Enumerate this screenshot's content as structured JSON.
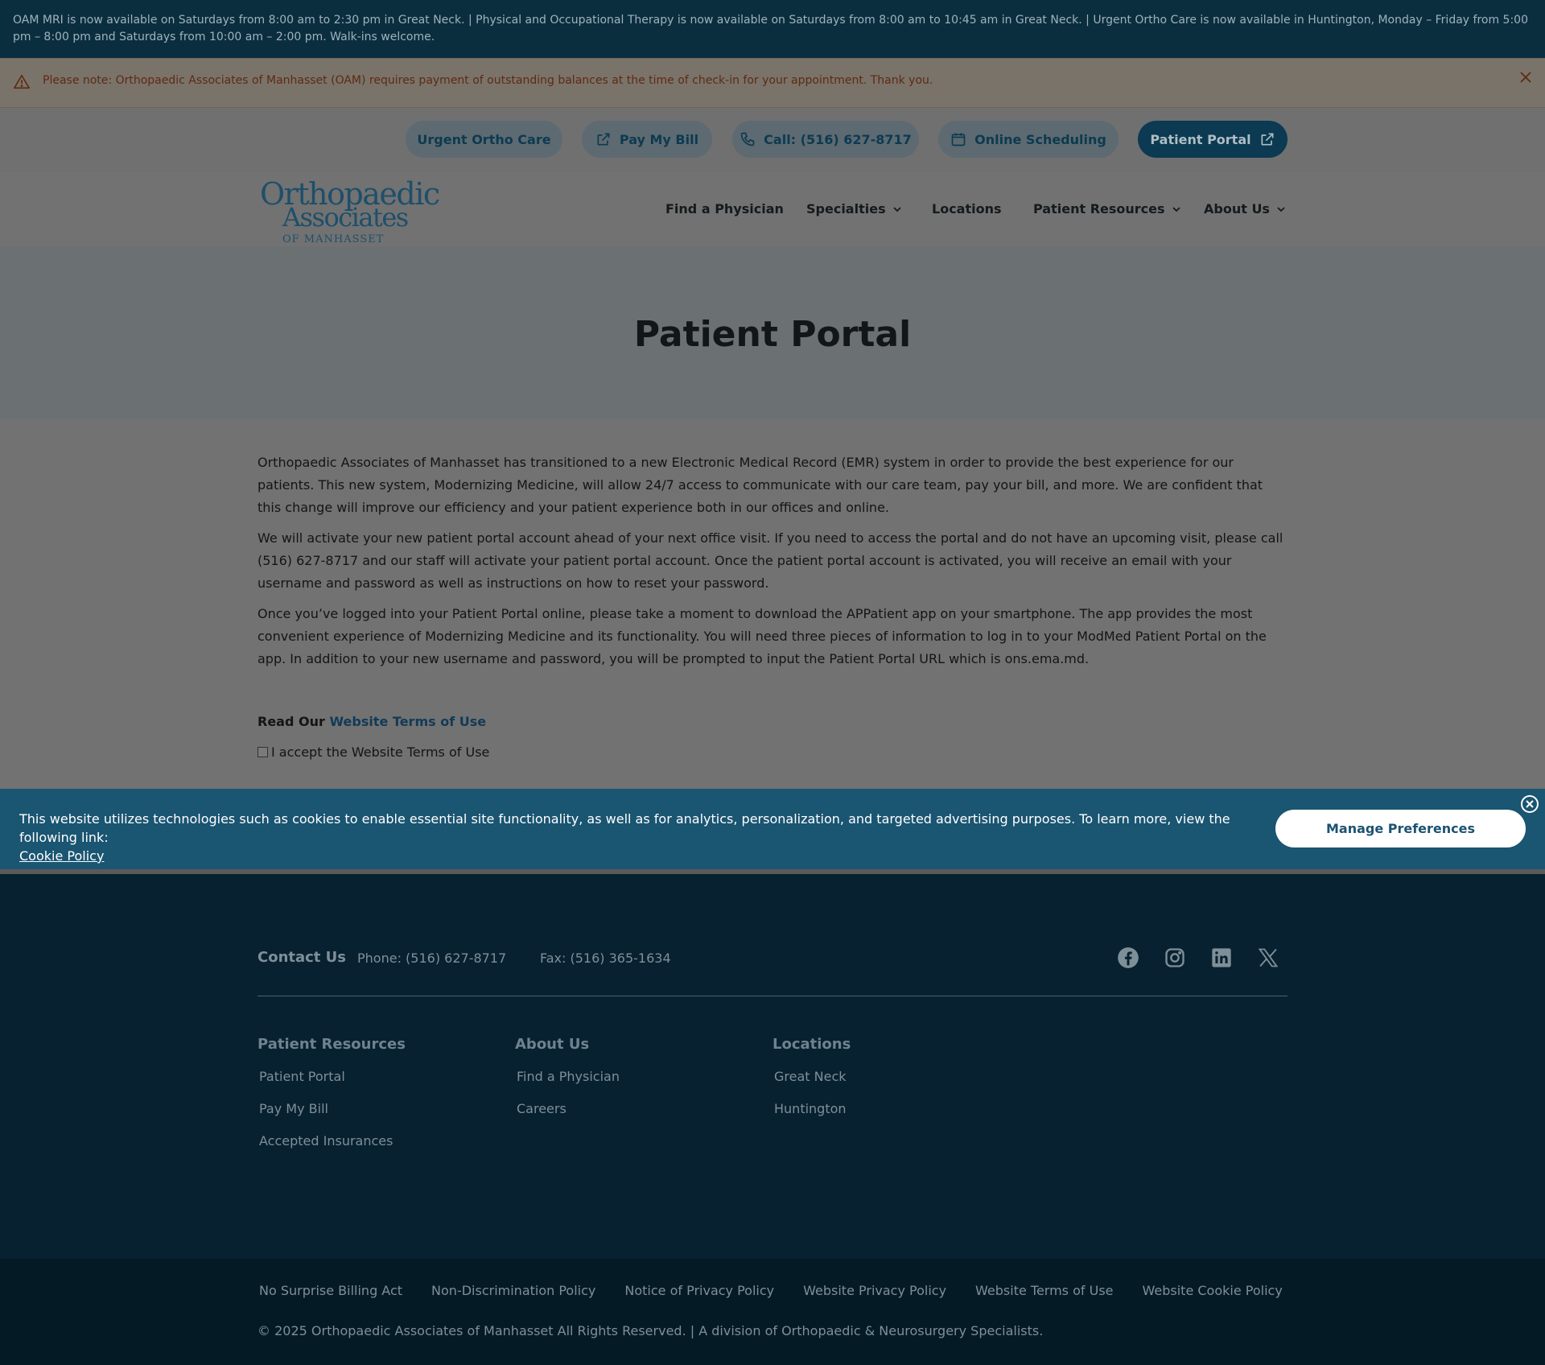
{
  "topbar": {
    "text": "OAM MRI is now available on Saturdays from 8:00 am to 2:30 pm in Great Neck. | Physical and Occupational Therapy is now available on Saturdays from 8:00 am to 10:45 am in Great Neck. | Urgent Ortho Care is now available in Huntington, Monday – Friday from 5:00 pm – 8:00 pm and Saturdays from 10:00 am – 2:00 pm. Walk-ins welcome."
  },
  "alert": {
    "message": "Please note: Orthopaedic Associates of Manhasset (OAM) requires payment of outstanding balances at the time of check-in for your appointment. Thank you."
  },
  "utility": {
    "urgent": "Urgent Ortho Care",
    "pay": "Pay My Bill",
    "call": "Call: (516) 627-8717",
    "scheduling": "Online Scheduling",
    "portal": "Patient Portal"
  },
  "logo": {
    "line1": "Orthopaedic",
    "line2": "Associates",
    "line3": "OF MANHASSET"
  },
  "nav": {
    "find": "Find a Physician",
    "specialties": "Specialties",
    "locations": "Locations",
    "resources": "Patient Resources",
    "about": "About Us"
  },
  "hero": {
    "title": "Patient Portal"
  },
  "content": {
    "p1": "Orthopaedic Associates of Manhasset has transitioned to a new Electronic Medical Record (EMR) system in order to provide the best experience for our patients. This new system, Modernizing Medicine, will allow 24/7 access to communicate with our care team, pay your bill, and more. We are confident that this change will improve our efficiency and your patient experience both in our offices and online.",
    "p2": "We will activate your new patient portal account ahead of your next office visit. If you need to access the portal and do not have an upcoming visit, please call (516) 627-8717 and our staff will activate your patient portal account. Once the patient portal account is activated, you will receive an email with your username and password as well as instructions on how to reset your password.",
    "p3": "Once you’ve logged into your Patient Portal online, please take a moment to download the APPatient app on your smartphone. The app provides the most convenient experience of Modernizing Medicine and its functionality. You will need three pieces of information to log in to your ModMed Patient Portal on the app. In addition to your new username and password, you will be prompted to input the Patient Portal URL which is ons.ema.md.",
    "read_prefix": "Read Our",
    "terms_link": "Website Terms of Use",
    "accept_label": "I accept the Website Terms of Use"
  },
  "cookie": {
    "text": "This website utilizes technologies such as cookies to enable essential site functionality, as well as for analytics, personalization, and targeted advertising purposes. To learn more, view the following link:",
    "link": "Cookie Policy",
    "button": "Manage Preferences"
  },
  "footer": {
    "contact_title": "Contact Us",
    "phone": "Phone: (516) 627-8717",
    "fax": "Fax: (516) 365-1634",
    "social_icons": [
      "facebook-icon",
      "instagram-icon",
      "linkedin-icon",
      "x-icon"
    ],
    "columns": [
      {
        "title": "Patient Resources",
        "links": [
          "Patient Portal",
          "Pay My Bill",
          "Accepted Insurances"
        ]
      },
      {
        "title": "About Us",
        "links": [
          "Find a Physician",
          "Careers"
        ]
      },
      {
        "title": "Locations",
        "links": [
          "Great Neck",
          "Huntington"
        ]
      }
    ],
    "legal_links": [
      "No Surprise Billing Act",
      "Non-Discrimination Policy",
      "Notice of Privacy Policy",
      "Website Privacy Policy",
      "Website Terms of Use",
      "Website Cookie Policy"
    ],
    "copyright": "© 2025 Orthopaedic Associates of Manhasset All Rights Reserved. | A division of Orthopaedic & Neurosurgery Specialists."
  },
  "colors": {
    "navy": "#0b2e3f",
    "cookie_bg": "#1a5571",
    "footer_bg": "#072130",
    "legal_bg": "#041a25"
  }
}
